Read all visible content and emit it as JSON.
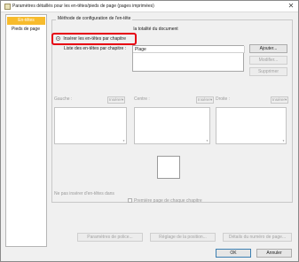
{
  "window": {
    "title": "Paramètres détaillés pour les en-têtes/pieds de page (pages imprimées)",
    "close_glyph": "✕"
  },
  "nav": {
    "items": [
      {
        "label": "En-têtes",
        "selected": true
      },
      {
        "label": "Pieds de page",
        "selected": false
      }
    ]
  },
  "method": {
    "group_label": "Méthode de configuration de l'en-tête",
    "option_whole_doc": "la totalité du document",
    "option_per_chapter": "Insérer les en-têtes par chapitre",
    "list_label": "Liste des en-têtes par chapitre :",
    "list_column": "Plage",
    "buttons": {
      "add": "Ajouter...",
      "modify": "Modifier...",
      "delete": "Supprimer"
    }
  },
  "sections": {
    "insert_label": "Insérer",
    "left": "Gauche :",
    "center": "Centre :",
    "right": "Droite :"
  },
  "exclusions": {
    "label": "Ne pas insérer d'en-têtes dans",
    "first_page_checkbox": "Première page de chaque chapitre"
  },
  "bottom_buttons": {
    "font": "Paramètres de police...",
    "position": "Réglage de la position...",
    "page_number": "Détails du numéro de page..."
  },
  "dialog_buttons": {
    "ok": "OK",
    "cancel": "Annuler"
  },
  "colors": {
    "selected_nav": "#f7bb2c",
    "highlight": "#e60012"
  }
}
